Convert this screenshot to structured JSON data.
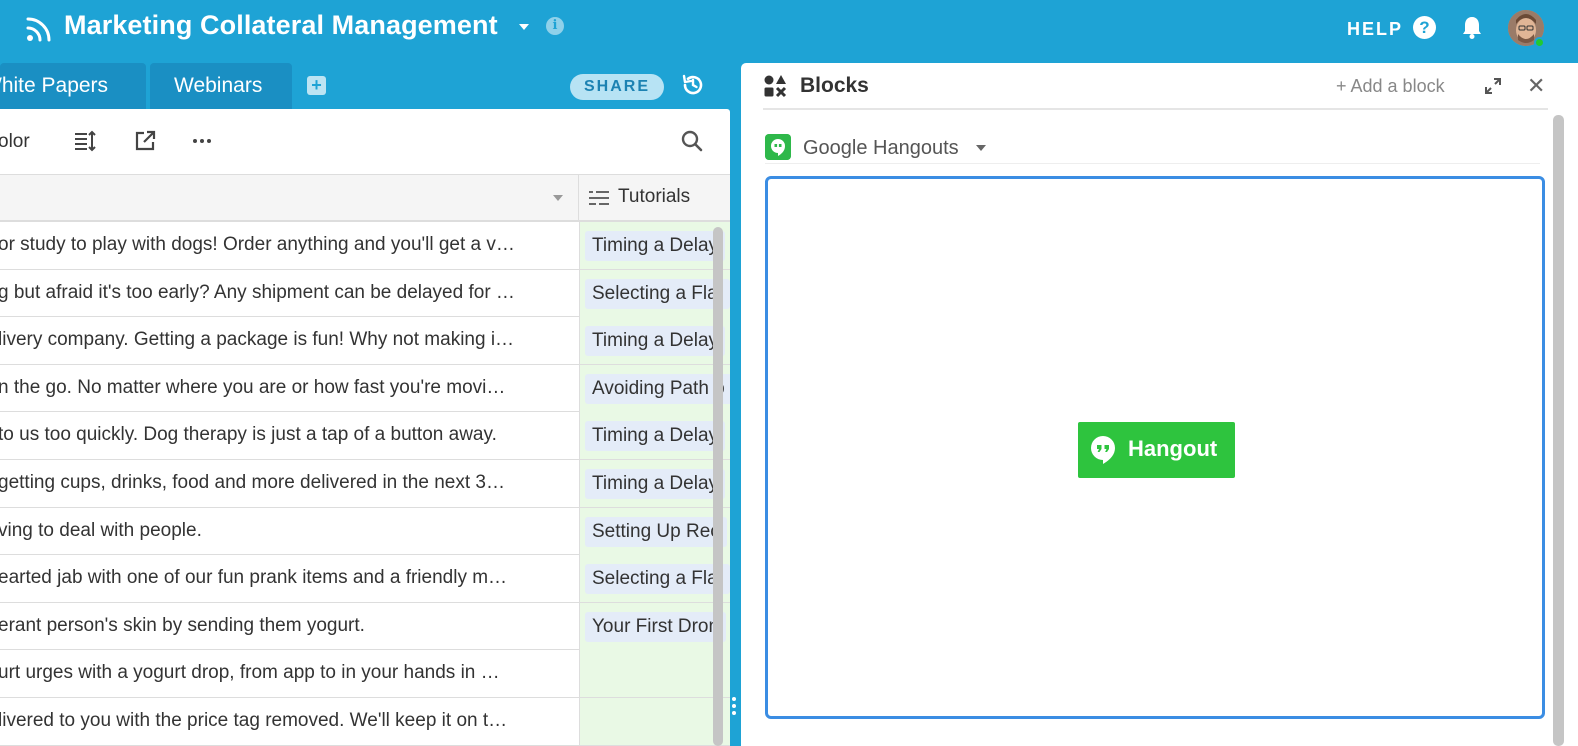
{
  "app": {
    "title": "Marketing Collateral Management",
    "info_icon": "i",
    "help_label": "HELP",
    "help_icon": "?"
  },
  "tabs": [
    {
      "label": "White Papers"
    },
    {
      "label": "Webinars"
    }
  ],
  "add_tab_icon": "+",
  "share_label": "SHARE",
  "toolbar": {
    "color_label": "olor"
  },
  "grid": {
    "tutorials_header": "Tutorials",
    "rows": [
      {
        "desc": "or study to play with dogs! Order anything and you'll get a v…",
        "tutorial": "Timing a Delay"
      },
      {
        "desc": "g but afraid it's too early? Any shipment can be delayed for …",
        "tutorial": "Selecting a Flat"
      },
      {
        "desc": "livery company. Getting a package is fun! Why not making i…",
        "tutorial": "Timing a Delay"
      },
      {
        "desc": "n the go. No matter where you are or how fast you're movi…",
        "tutorial": "Avoiding Path o"
      },
      {
        "desc": " to us too quickly. Dog therapy is just a tap of a button away.",
        "tutorial": "Timing a Delay"
      },
      {
        "desc": "getting cups, drinks, food and more delivered in the next 3…",
        "tutorial": "Timing a Delay"
      },
      {
        "desc": "ving to deal with people.",
        "tutorial": "Setting Up Rec"
      },
      {
        "desc": "earted jab with one of our fun prank items and a friendly m…",
        "tutorial": "Selecting a Flat"
      },
      {
        "desc": "erant person's skin by sending them yogurt.",
        "tutorial": "Your First Dron"
      },
      {
        "desc": "urt urges with a yogurt drop, from app to in your hands in …",
        "tutorial": ""
      },
      {
        "desc": "livered to you with the price tag removed. We'll keep it on t…",
        "tutorial": ""
      }
    ]
  },
  "blocks": {
    "title": "Blocks",
    "add_label": "+ Add a block",
    "close_label": "✕",
    "selected_block": "Google Hangouts",
    "hangout_button": "Hangout"
  },
  "colors": {
    "topbar": "#1ea3d5",
    "tab": "#1a8fc3",
    "hangout_green": "#2ec43e",
    "frame_blue": "#3b8de3",
    "tutorial_cell": "#e9f9e5",
    "pill": "#e4ecf8"
  }
}
